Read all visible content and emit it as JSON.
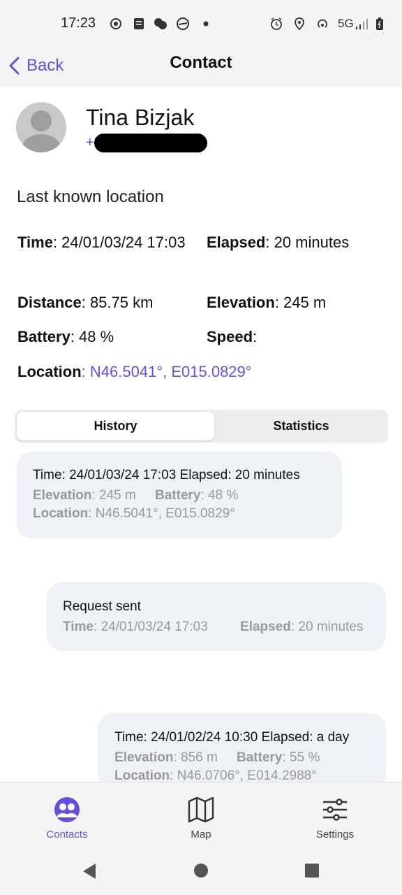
{
  "status_bar": {
    "time": "17:23",
    "network": "5G",
    "left_icons": [
      "record-icon",
      "notes-icon",
      "chat-icon",
      "speedometer-icon",
      "dot-icon"
    ],
    "right_icons": [
      "alarm-icon",
      "location-icon",
      "hotspot-icon",
      "signal-icon",
      "battery-icon"
    ]
  },
  "header": {
    "back_label": "Back",
    "title": "Contact"
  },
  "contact": {
    "name": "Tina Bizjak",
    "phone_visible": "+3"
  },
  "last_location": {
    "section_title": "Last known location",
    "time_label": "Time",
    "time_value": ": 24/01/03/24 17:03",
    "elapsed_label": "Elapsed",
    "elapsed_value": ": 20 minutes",
    "distance_label": "Distance",
    "distance_value": ": 85.75 km",
    "elevation_label": "Elevation",
    "elevation_value": ": 245 m",
    "battery_label": "Battery",
    "battery_value": ": 48 %",
    "speed_label": "Speed",
    "speed_value": ":",
    "location_label": "Location",
    "location_sep": ": ",
    "location_value": "N46.5041°, E015.0829°"
  },
  "tabs": [
    {
      "label": "History",
      "active": true
    },
    {
      "label": "Statistics",
      "active": false
    }
  ],
  "history": [
    {
      "line1": "Time: 24/01/03/24 17:03 Elapsed: 20 minutes",
      "elevation_label": "Elevation",
      "elevation_value": ": 245 m",
      "battery_label": "Battery",
      "battery_value": ": 48 %",
      "location_label": "Location",
      "location_value": ": N46.5041°, E015.0829°"
    },
    {
      "line1": "Request sent",
      "time_label": "Time",
      "time_value": ": 24/01/03/24 17:03",
      "elapsed_label": "Elapsed",
      "elapsed_value": ": 20 minutes"
    },
    {
      "line1": "Time: 24/01/02/24 10:30 Elapsed: a day",
      "elevation_label": "Elevation",
      "elevation_value": ": 856 m",
      "battery_label": "Battery",
      "battery_value": ": 55 %",
      "location_label": "Location",
      "location_value": ": N46.0706°, E014.2988°"
    }
  ],
  "bottom_nav": [
    {
      "label": "Contacts",
      "icon": "contacts-icon",
      "active": true
    },
    {
      "label": "Map",
      "icon": "map-icon",
      "active": false
    },
    {
      "label": "Settings",
      "icon": "settings-icon",
      "active": false
    }
  ],
  "colors": {
    "accent": "#6750d6",
    "card_bg": "#eef1f5",
    "muted_text": "#999999"
  }
}
